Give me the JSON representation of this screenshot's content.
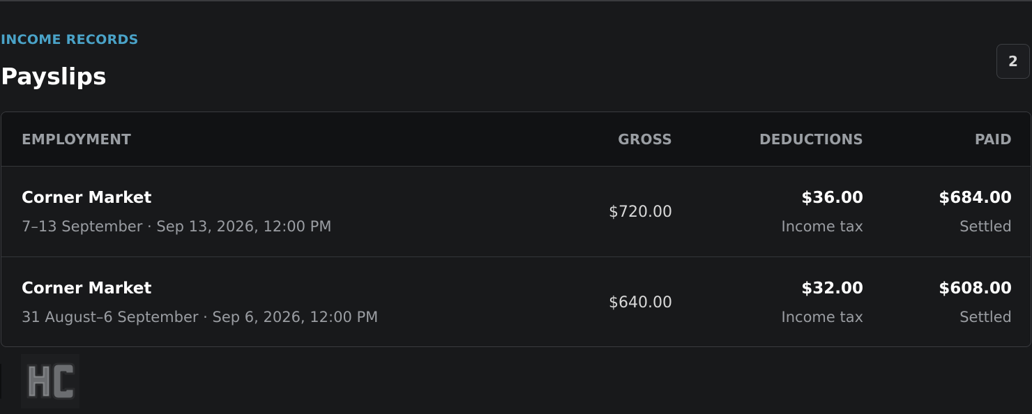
{
  "header": {
    "eyebrow": "INCOME RECORDS",
    "title": "Payslips",
    "count": "2"
  },
  "table": {
    "columns": {
      "employment": "EMPLOYMENT",
      "gross": "GROSS",
      "deductions": "DEDUCTIONS",
      "paid": "PAID"
    },
    "rows": [
      {
        "employer": "Corner Market",
        "meta": "7–13 September · Sep 13, 2026, 12:00 PM",
        "gross": "$720.00",
        "deductions": "$36.00",
        "deduction_label": "Income tax",
        "paid": "$684.00",
        "status": "Settled"
      },
      {
        "employer": "Corner Market",
        "meta": "31 August–6 September · Sep 6, 2026, 12:00 PM",
        "gross": "$640.00",
        "deductions": "$32.00",
        "deduction_label": "Income tax",
        "paid": "$608.00",
        "status": "Settled"
      }
    ]
  },
  "logo": {
    "icon": "hc-logo-icon",
    "text": "HC"
  }
}
